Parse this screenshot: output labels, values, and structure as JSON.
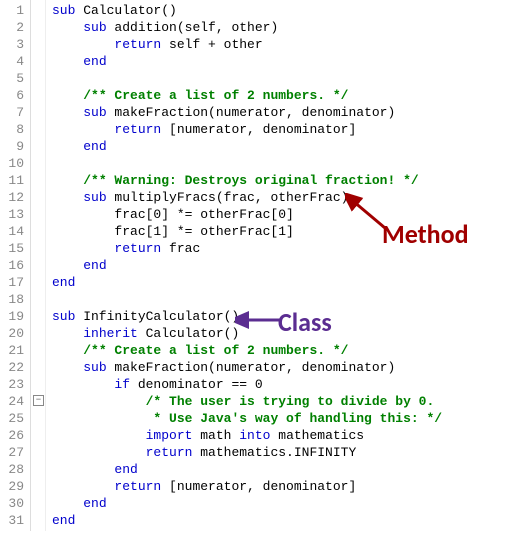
{
  "annotations": {
    "method": "Method",
    "class": "Class"
  },
  "fold_glyph": "−",
  "lines": [
    {
      "n": "1",
      "t": [
        [
          "kw",
          "sub"
        ],
        [
          "id",
          " Calculator()"
        ]
      ]
    },
    {
      "n": "2",
      "t": [
        [
          "id",
          "    "
        ],
        [
          "kw",
          "sub"
        ],
        [
          "id",
          " addition(self, other)"
        ]
      ]
    },
    {
      "n": "3",
      "t": [
        [
          "id",
          "        "
        ],
        [
          "kw",
          "return"
        ],
        [
          "id",
          " self + other"
        ]
      ]
    },
    {
      "n": "4",
      "t": [
        [
          "id",
          "    "
        ],
        [
          "kw",
          "end"
        ]
      ]
    },
    {
      "n": "5",
      "t": [
        [
          "id",
          ""
        ]
      ]
    },
    {
      "n": "6",
      "t": [
        [
          "id",
          "    "
        ],
        [
          "cm",
          "/** Create a list of 2 numbers. */"
        ]
      ]
    },
    {
      "n": "7",
      "t": [
        [
          "id",
          "    "
        ],
        [
          "kw",
          "sub"
        ],
        [
          "id",
          " makeFraction(numerator, denominator)"
        ]
      ]
    },
    {
      "n": "8",
      "t": [
        [
          "id",
          "        "
        ],
        [
          "kw",
          "return"
        ],
        [
          "id",
          " [numerator, denominator]"
        ]
      ]
    },
    {
      "n": "9",
      "t": [
        [
          "id",
          "    "
        ],
        [
          "kw",
          "end"
        ]
      ]
    },
    {
      "n": "10",
      "t": [
        [
          "id",
          ""
        ]
      ]
    },
    {
      "n": "11",
      "t": [
        [
          "id",
          "    "
        ],
        [
          "cm",
          "/** Warning: Destroys original fraction! */"
        ]
      ]
    },
    {
      "n": "12",
      "t": [
        [
          "id",
          "    "
        ],
        [
          "kw",
          "sub"
        ],
        [
          "id",
          " multiplyFracs(frac, otherFrac)"
        ]
      ]
    },
    {
      "n": "13",
      "t": [
        [
          "id",
          "        frac[0] *= otherFrac[0]"
        ]
      ]
    },
    {
      "n": "14",
      "t": [
        [
          "id",
          "        frac[1] *= otherFrac[1]"
        ]
      ]
    },
    {
      "n": "15",
      "t": [
        [
          "id",
          "        "
        ],
        [
          "kw",
          "return"
        ],
        [
          "id",
          " frac"
        ]
      ]
    },
    {
      "n": "16",
      "t": [
        [
          "id",
          "    "
        ],
        [
          "kw",
          "end"
        ]
      ]
    },
    {
      "n": "17",
      "t": [
        [
          "kw",
          "end"
        ]
      ]
    },
    {
      "n": "18",
      "t": [
        [
          "id",
          ""
        ]
      ]
    },
    {
      "n": "19",
      "t": [
        [
          "kw",
          "sub"
        ],
        [
          "id",
          " InfinityCalculator()"
        ]
      ]
    },
    {
      "n": "20",
      "t": [
        [
          "id",
          "    "
        ],
        [
          "kw",
          "inherit"
        ],
        [
          "id",
          " Calculator()"
        ]
      ]
    },
    {
      "n": "21",
      "t": [
        [
          "id",
          "    "
        ],
        [
          "cm",
          "/** Create a list of 2 numbers. */"
        ]
      ]
    },
    {
      "n": "22",
      "t": [
        [
          "id",
          "    "
        ],
        [
          "kw",
          "sub"
        ],
        [
          "id",
          " makeFraction(numerator, denominator)"
        ]
      ]
    },
    {
      "n": "23",
      "t": [
        [
          "id",
          "        "
        ],
        [
          "kw",
          "if"
        ],
        [
          "id",
          " denominator == 0"
        ]
      ]
    },
    {
      "n": "24",
      "t": [
        [
          "id",
          "            "
        ],
        [
          "cm",
          "/* The user is trying to divide by 0."
        ]
      ]
    },
    {
      "n": "25",
      "t": [
        [
          "id",
          "            "
        ],
        [
          "cm",
          " * Use Java's way of handling this: */"
        ]
      ]
    },
    {
      "n": "26",
      "t": [
        [
          "id",
          "            "
        ],
        [
          "kw",
          "import"
        ],
        [
          "id",
          " math "
        ],
        [
          "kw",
          "into"
        ],
        [
          "id",
          " mathematics"
        ]
      ]
    },
    {
      "n": "27",
      "t": [
        [
          "id",
          "            "
        ],
        [
          "kw",
          "return"
        ],
        [
          "id",
          " mathematics.INFINITY"
        ]
      ]
    },
    {
      "n": "28",
      "t": [
        [
          "id",
          "        "
        ],
        [
          "kw",
          "end"
        ]
      ]
    },
    {
      "n": "29",
      "t": [
        [
          "id",
          "        "
        ],
        [
          "kw",
          "return"
        ],
        [
          "id",
          " [numerator, denominator]"
        ]
      ]
    },
    {
      "n": "30",
      "t": [
        [
          "id",
          "    "
        ],
        [
          "kw",
          "end"
        ]
      ]
    },
    {
      "n": "31",
      "t": [
        [
          "kw",
          "end"
        ]
      ]
    }
  ]
}
